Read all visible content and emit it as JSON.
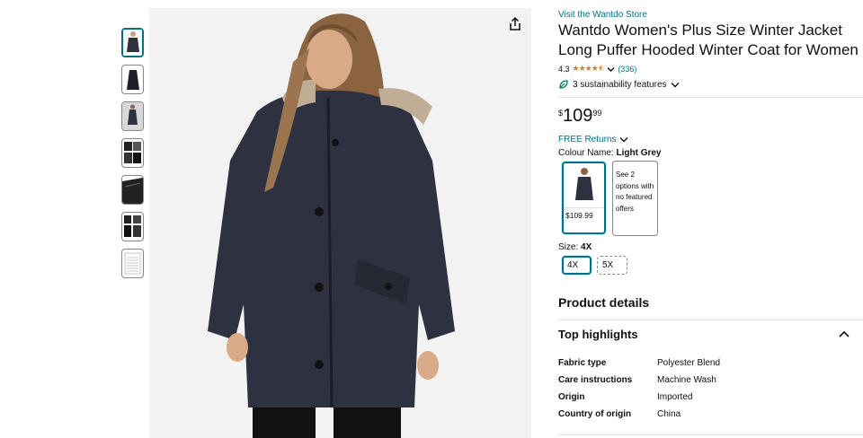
{
  "thumbnails": [
    {
      "name": "thumb-model-front",
      "selected": true
    },
    {
      "name": "thumb-jacket-front",
      "selected": false
    },
    {
      "name": "thumb-model-snow",
      "selected": false
    },
    {
      "name": "thumb-details-collage",
      "selected": false
    },
    {
      "name": "thumb-fabric-closeup",
      "selected": false
    },
    {
      "name": "thumb-features-collage",
      "selected": false
    },
    {
      "name": "thumb-size-chart",
      "selected": false
    }
  ],
  "store_link": "Visit the Wantdo Store",
  "title": "Wantdo Women's Plus Size Winter Jacket Long Puffer Hooded Winter Coat for Women",
  "rating": {
    "value": "4.3",
    "count": "(336)",
    "stars": "★★★★⯪"
  },
  "sustainability": "3 sustainability features",
  "price": {
    "symbol": "$",
    "whole": "109",
    "fraction": "99"
  },
  "returns": "FREE Returns",
  "colour": {
    "label": "Colour Name:",
    "value": "Light Grey"
  },
  "colour_options": [
    {
      "price": "$109.99"
    },
    {
      "text": "See 2 options with no featured offers"
    }
  ],
  "size": {
    "label": "Size:",
    "value": "4X",
    "options": [
      "4X",
      "5X"
    ]
  },
  "product_details_heading": "Product details",
  "top_highlights_heading": "Top highlights",
  "specs": [
    {
      "key": "Fabric type",
      "value": "Polyester Blend"
    },
    {
      "key": "Care instructions",
      "value": "Machine Wash"
    },
    {
      "key": "Origin",
      "value": "Imported"
    },
    {
      "key": "Country of origin",
      "value": "China"
    }
  ],
  "colors": {
    "link": "#007185",
    "star": "#de7921",
    "jacket": "#2e3140"
  }
}
